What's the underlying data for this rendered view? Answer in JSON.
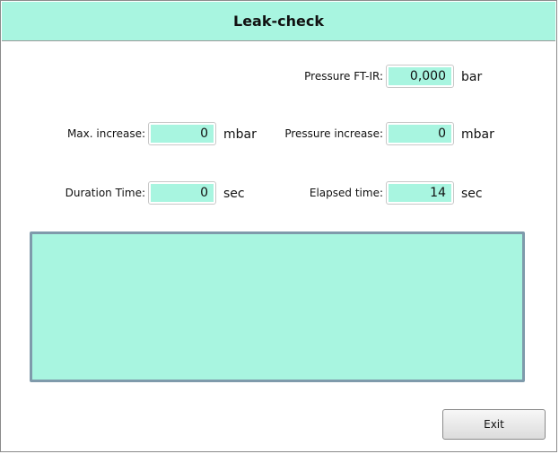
{
  "window": {
    "title": "Leak-check"
  },
  "fields": {
    "pressure_ftir": {
      "label": "Pressure FT-IR:",
      "value": "0,000",
      "unit": "bar"
    },
    "max_increase": {
      "label": "Max. increase:",
      "value": "0",
      "unit": "mbar"
    },
    "pressure_increase": {
      "label": "Pressure increase:",
      "value": "0",
      "unit": "mbar"
    },
    "duration_time": {
      "label": "Duration Time:",
      "value": "0",
      "unit": "sec"
    },
    "elapsed_time": {
      "label": "Elapsed time:",
      "value": "14",
      "unit": "sec"
    }
  },
  "log": {
    "text": ""
  },
  "buttons": {
    "exit_label": "Exit"
  },
  "colors": {
    "accent": "#a8f5e0",
    "log_border": "#7f9aab"
  }
}
